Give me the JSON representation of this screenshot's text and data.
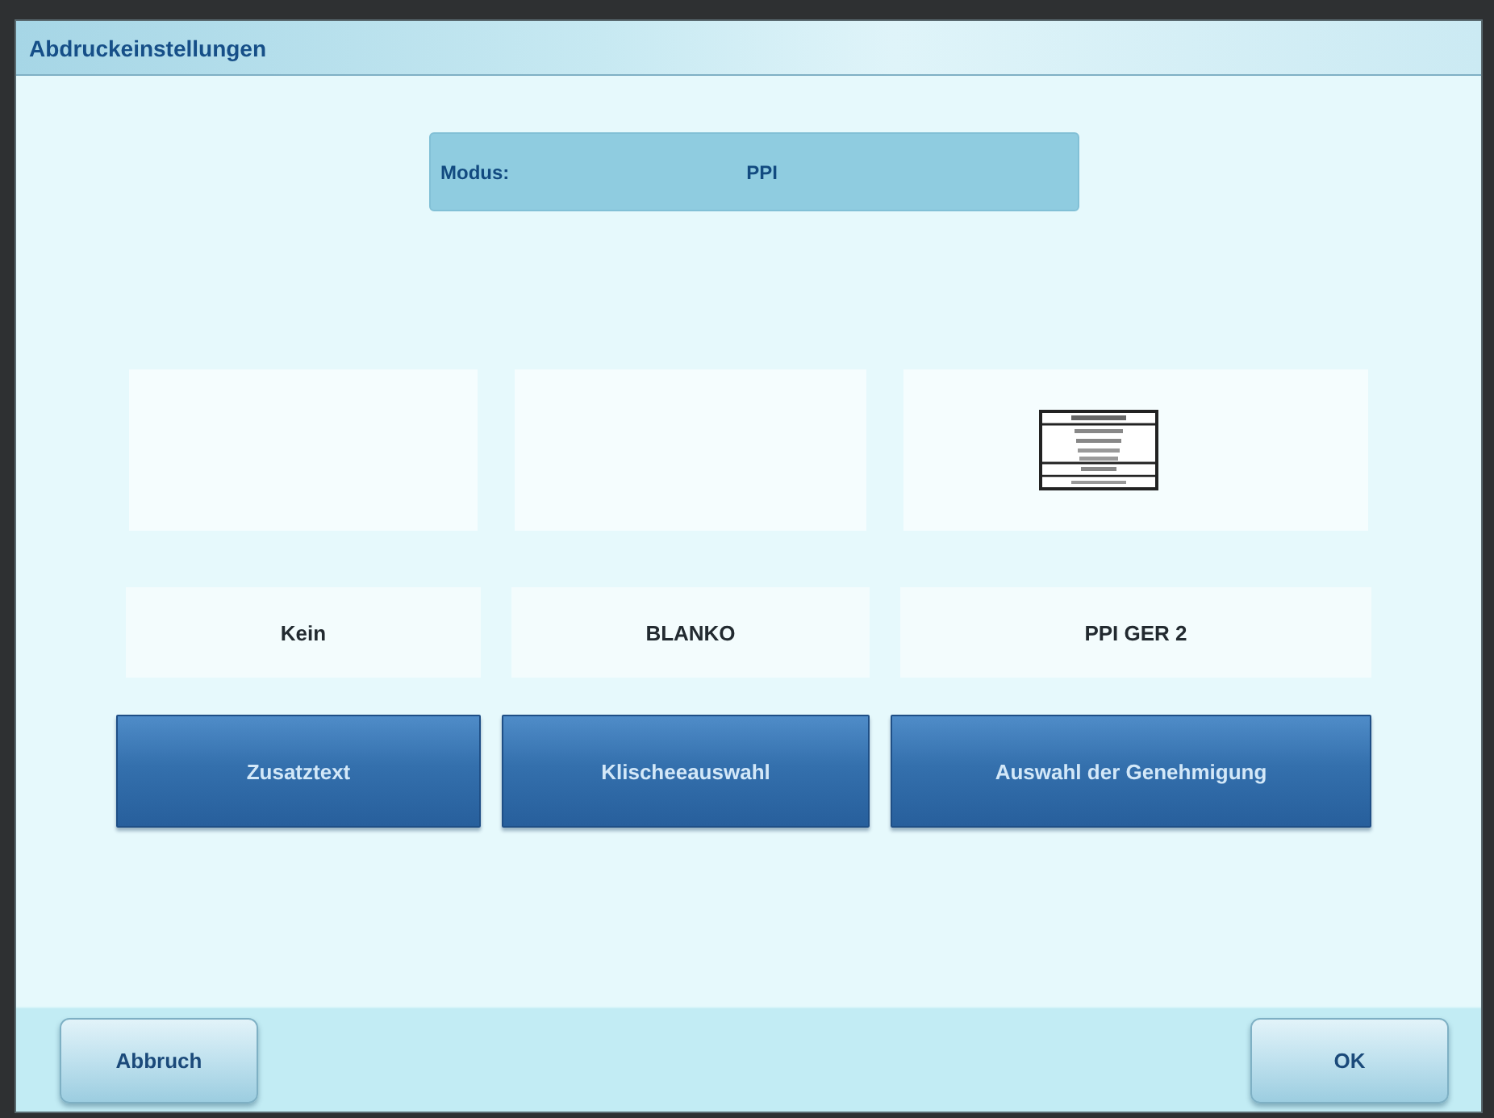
{
  "window": {
    "title": "Abdruckeinstellungen"
  },
  "mode": {
    "label": "Modus:",
    "value": "PPI"
  },
  "options": [
    {
      "kind": "blank",
      "value": "Kein",
      "button": "Zusatztext"
    },
    {
      "kind": "blank",
      "value": "BLANKO",
      "button": "Klischeeauswahl"
    },
    {
      "kind": "stamp",
      "value": "PPI GER 2",
      "button": "Auswahl der Genehmigung"
    }
  ],
  "footer": {
    "buttons": [
      "Abbruch",
      "OK"
    ]
  }
}
